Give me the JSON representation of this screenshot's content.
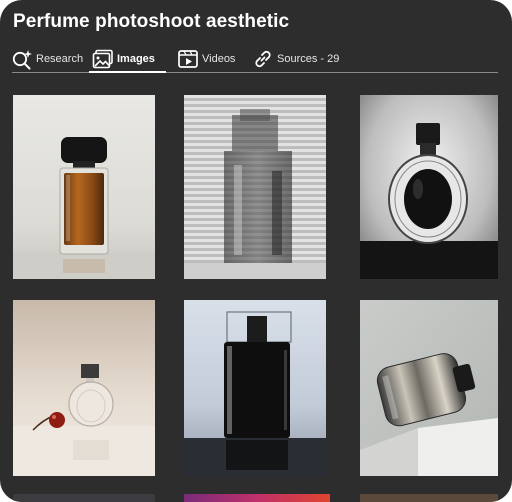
{
  "header": {
    "title": "Perfume photoshoot aesthetic"
  },
  "tabs": [
    {
      "label": "Research",
      "icon": "research-sparkle-icon",
      "active": false
    },
    {
      "label": "Images",
      "icon": "images-icon",
      "active": true
    },
    {
      "label": "Videos",
      "icon": "videos-icon",
      "active": false
    },
    {
      "label": "Sources - 29",
      "icon": "link-icon",
      "active": false
    }
  ],
  "colors": {
    "panel_background": "#2d2d2d",
    "title_text": "#ffffff",
    "tab_text": "#e6e6e6",
    "active_underline": "#ffffff"
  },
  "images": [
    {
      "subject": "amber perfume bottle with black cap on light grey background"
    },
    {
      "subject": "blurred perfume bottle behind horizontal blinds"
    },
    {
      "subject": "clear round perfume bottle with black center on grey backdrop"
    },
    {
      "subject": "small clear perfume bottle beside a red cherry"
    },
    {
      "subject": "dark rectangular perfume bottle with reflection"
    },
    {
      "subject": "tilted metallic perfume bottle on white pedestal"
    }
  ]
}
